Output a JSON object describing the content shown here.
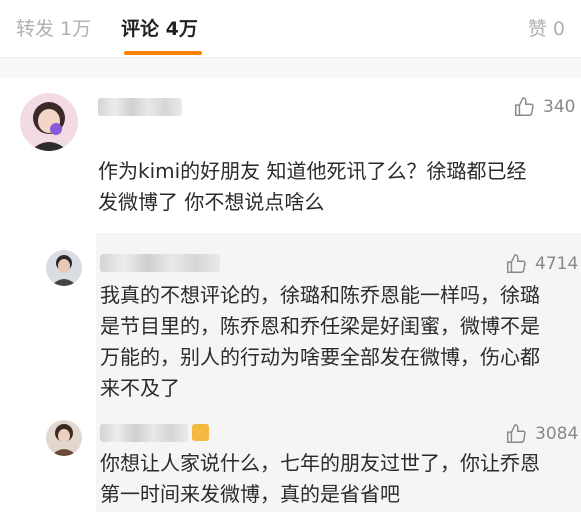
{
  "tabs": {
    "repost_label": "转发 1万",
    "comment_label": "评论 4万",
    "like_label": "赞 0",
    "active": "comment"
  },
  "comments": [
    {
      "likes": "340",
      "text_lines": [
        "作为kimi的好朋友 知道他死讯了么？徐璐都已经",
        "发微博了 你不想说点啥么"
      ]
    }
  ],
  "replies": [
    {
      "likes": "4714",
      "text_lines": [
        "我真的不想评论的，徐璐和陈乔恩能一样吗，徐璐",
        "是节目里的，陈乔恩和乔任梁是好闺蜜，微博不是",
        "万能的，别人的行动为啥要全部发在微博，伤心都",
        "来不及了"
      ]
    },
    {
      "likes": "3084",
      "text_lines": [
        "你想让人家说什么，七年的朋友过世了，你让乔恩",
        "第一时间来发微博，真的是省省吧"
      ]
    }
  ],
  "colors": {
    "accent": "#ff8200",
    "muted": "#888888",
    "reply_bg": "#f5f5f5"
  }
}
